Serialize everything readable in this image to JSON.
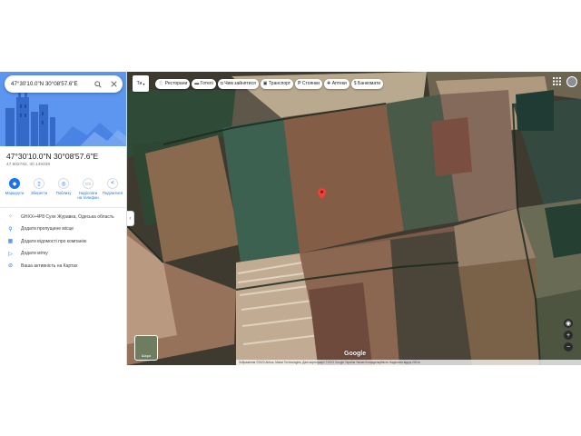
{
  "search": {
    "value": "47°30'10.0\"N 30°08'57.6\"E"
  },
  "place": {
    "title": "47°30'10.0\"N 30°08'57.6\"E",
    "coordinates": "47.502782, 30.149338"
  },
  "actions": [
    {
      "label": "Маршрути",
      "icon": "directions-icon"
    },
    {
      "label": "Зберегти",
      "icon": "bookmark-icon"
    },
    {
      "label": "Поблизу",
      "icon": "nearby-icon"
    },
    {
      "label": "Надіслати на телефон",
      "icon": "phone-icon"
    },
    {
      "label": "Поділитися",
      "icon": "share-icon"
    }
  ],
  "info_rows": [
    {
      "icon": "plus-code-icon",
      "text": "GHXX+4P8 Сухе Журавка, Одеська область"
    },
    {
      "icon": "add-place-icon",
      "text": "Додати пропущене місце"
    },
    {
      "icon": "add-business-icon",
      "text": "Додати відомості про компанію"
    },
    {
      "icon": "label-icon",
      "text": "Додати мітку"
    },
    {
      "icon": "history-icon",
      "text": "Ваша активність на Картах"
    }
  ],
  "map": {
    "type_select": "Ти",
    "chips": [
      {
        "label": "Ресторани",
        "icon": "🍴"
      },
      {
        "label": "Готелі",
        "icon": "🛏"
      },
      {
        "label": "Чим зайнятися",
        "icon": "📷"
      },
      {
        "label": "Транспорт",
        "icon": "🚌"
      },
      {
        "label": "Стоянки",
        "icon": "P"
      },
      {
        "label": "Аптеки",
        "icon": "💊"
      },
      {
        "label": "Банкомати",
        "icon": "$"
      }
    ],
    "logo": "Google",
    "layers_label": "Шари",
    "attribution": "Зображення ©2023 Airbus, Maxar Technologies, Дані картографії ©2023 Google   Україна   Умови   Конфіденційність   Надіслати відгук   200 м"
  },
  "colors": {
    "accent": "#1a73e8",
    "hero_top": "#4f8ff0"
  }
}
